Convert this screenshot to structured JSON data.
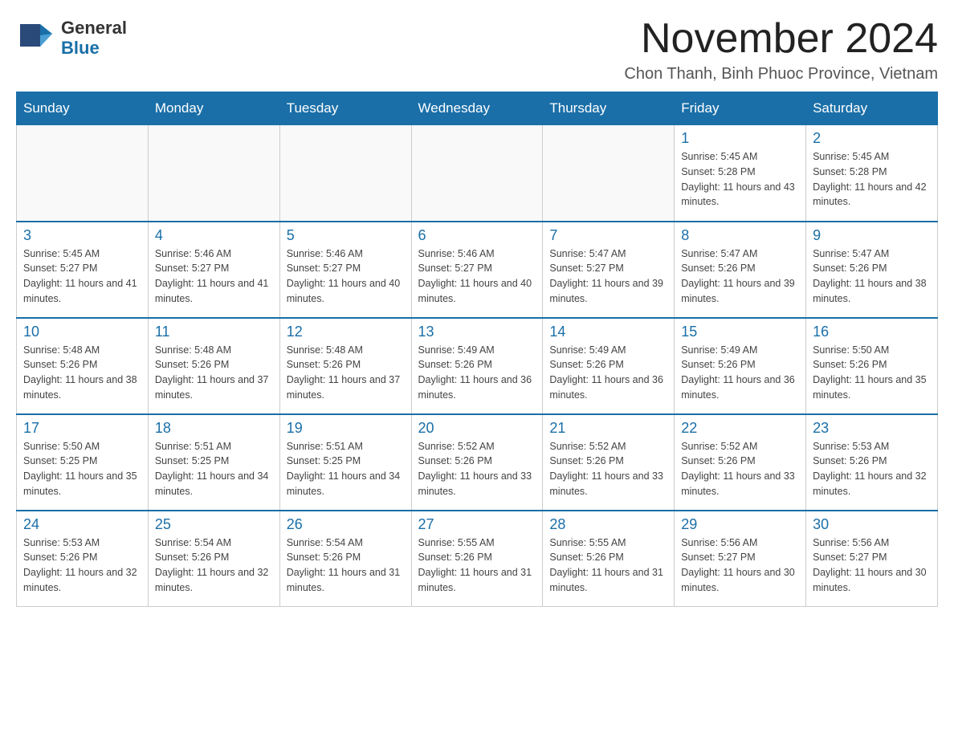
{
  "header": {
    "logo": {
      "general": "General",
      "blue": "Blue"
    },
    "title": "November 2024",
    "location": "Chon Thanh, Binh Phuoc Province, Vietnam"
  },
  "weekdays": [
    "Sunday",
    "Monday",
    "Tuesday",
    "Wednesday",
    "Thursday",
    "Friday",
    "Saturday"
  ],
  "weeks": [
    [
      {
        "day": "",
        "info": ""
      },
      {
        "day": "",
        "info": ""
      },
      {
        "day": "",
        "info": ""
      },
      {
        "day": "",
        "info": ""
      },
      {
        "day": "",
        "info": ""
      },
      {
        "day": "1",
        "info": "Sunrise: 5:45 AM\nSunset: 5:28 PM\nDaylight: 11 hours and 43 minutes."
      },
      {
        "day": "2",
        "info": "Sunrise: 5:45 AM\nSunset: 5:28 PM\nDaylight: 11 hours and 42 minutes."
      }
    ],
    [
      {
        "day": "3",
        "info": "Sunrise: 5:45 AM\nSunset: 5:27 PM\nDaylight: 11 hours and 41 minutes."
      },
      {
        "day": "4",
        "info": "Sunrise: 5:46 AM\nSunset: 5:27 PM\nDaylight: 11 hours and 41 minutes."
      },
      {
        "day": "5",
        "info": "Sunrise: 5:46 AM\nSunset: 5:27 PM\nDaylight: 11 hours and 40 minutes."
      },
      {
        "day": "6",
        "info": "Sunrise: 5:46 AM\nSunset: 5:27 PM\nDaylight: 11 hours and 40 minutes."
      },
      {
        "day": "7",
        "info": "Sunrise: 5:47 AM\nSunset: 5:27 PM\nDaylight: 11 hours and 39 minutes."
      },
      {
        "day": "8",
        "info": "Sunrise: 5:47 AM\nSunset: 5:26 PM\nDaylight: 11 hours and 39 minutes."
      },
      {
        "day": "9",
        "info": "Sunrise: 5:47 AM\nSunset: 5:26 PM\nDaylight: 11 hours and 38 minutes."
      }
    ],
    [
      {
        "day": "10",
        "info": "Sunrise: 5:48 AM\nSunset: 5:26 PM\nDaylight: 11 hours and 38 minutes."
      },
      {
        "day": "11",
        "info": "Sunrise: 5:48 AM\nSunset: 5:26 PM\nDaylight: 11 hours and 37 minutes."
      },
      {
        "day": "12",
        "info": "Sunrise: 5:48 AM\nSunset: 5:26 PM\nDaylight: 11 hours and 37 minutes."
      },
      {
        "day": "13",
        "info": "Sunrise: 5:49 AM\nSunset: 5:26 PM\nDaylight: 11 hours and 36 minutes."
      },
      {
        "day": "14",
        "info": "Sunrise: 5:49 AM\nSunset: 5:26 PM\nDaylight: 11 hours and 36 minutes."
      },
      {
        "day": "15",
        "info": "Sunrise: 5:49 AM\nSunset: 5:26 PM\nDaylight: 11 hours and 36 minutes."
      },
      {
        "day": "16",
        "info": "Sunrise: 5:50 AM\nSunset: 5:26 PM\nDaylight: 11 hours and 35 minutes."
      }
    ],
    [
      {
        "day": "17",
        "info": "Sunrise: 5:50 AM\nSunset: 5:25 PM\nDaylight: 11 hours and 35 minutes."
      },
      {
        "day": "18",
        "info": "Sunrise: 5:51 AM\nSunset: 5:25 PM\nDaylight: 11 hours and 34 minutes."
      },
      {
        "day": "19",
        "info": "Sunrise: 5:51 AM\nSunset: 5:25 PM\nDaylight: 11 hours and 34 minutes."
      },
      {
        "day": "20",
        "info": "Sunrise: 5:52 AM\nSunset: 5:26 PM\nDaylight: 11 hours and 33 minutes."
      },
      {
        "day": "21",
        "info": "Sunrise: 5:52 AM\nSunset: 5:26 PM\nDaylight: 11 hours and 33 minutes."
      },
      {
        "day": "22",
        "info": "Sunrise: 5:52 AM\nSunset: 5:26 PM\nDaylight: 11 hours and 33 minutes."
      },
      {
        "day": "23",
        "info": "Sunrise: 5:53 AM\nSunset: 5:26 PM\nDaylight: 11 hours and 32 minutes."
      }
    ],
    [
      {
        "day": "24",
        "info": "Sunrise: 5:53 AM\nSunset: 5:26 PM\nDaylight: 11 hours and 32 minutes."
      },
      {
        "day": "25",
        "info": "Sunrise: 5:54 AM\nSunset: 5:26 PM\nDaylight: 11 hours and 32 minutes."
      },
      {
        "day": "26",
        "info": "Sunrise: 5:54 AM\nSunset: 5:26 PM\nDaylight: 11 hours and 31 minutes."
      },
      {
        "day": "27",
        "info": "Sunrise: 5:55 AM\nSunset: 5:26 PM\nDaylight: 11 hours and 31 minutes."
      },
      {
        "day": "28",
        "info": "Sunrise: 5:55 AM\nSunset: 5:26 PM\nDaylight: 11 hours and 31 minutes."
      },
      {
        "day": "29",
        "info": "Sunrise: 5:56 AM\nSunset: 5:27 PM\nDaylight: 11 hours and 30 minutes."
      },
      {
        "day": "30",
        "info": "Sunrise: 5:56 AM\nSunset: 5:27 PM\nDaylight: 11 hours and 30 minutes."
      }
    ]
  ]
}
